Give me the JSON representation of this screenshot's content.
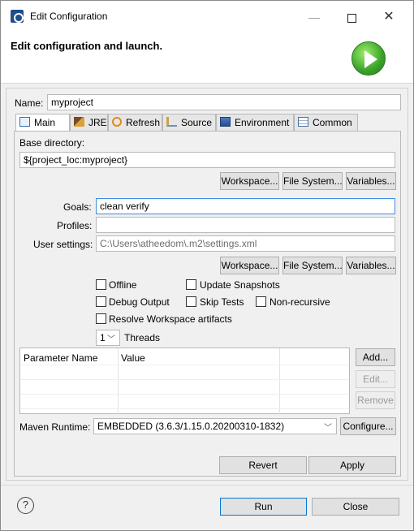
{
  "window": {
    "title": "Edit Configuration"
  },
  "banner": {
    "title": "Edit configuration and launch."
  },
  "name": {
    "label": "Name:",
    "value": "myproject"
  },
  "tabs": [
    {
      "label": "Main",
      "icon": "main-tab-icon",
      "active": true
    },
    {
      "label": "JRE",
      "icon": "jre-icon"
    },
    {
      "label": "Refresh",
      "icon": "refresh-icon"
    },
    {
      "label": "Source",
      "icon": "source-icon"
    },
    {
      "label": "Environment",
      "icon": "environment-icon"
    },
    {
      "label": "Common",
      "icon": "common-icon"
    }
  ],
  "main": {
    "base_dir_label": "Base directory:",
    "base_dir_value": "${project_loc:myproject}",
    "workspace_btn": "Workspace...",
    "filesystem_btn": "File System...",
    "variables_btn": "Variables...",
    "goals_label": "Goals:",
    "goals_value": "clean verify",
    "profiles_label": "Profiles:",
    "profiles_value": "",
    "user_settings_label": "User settings:",
    "user_settings_value": "C:\\Users\\atheedom\\.m2\\settings.xml",
    "options": {
      "offline": "Offline",
      "update_snapshots": "Update Snapshots",
      "debug_output": "Debug Output",
      "skip_tests": "Skip Tests",
      "non_recursive": "Non-recursive",
      "resolve_workspace": "Resolve Workspace artifacts"
    },
    "threads_value": "1",
    "threads_label": "Threads",
    "table": {
      "headers": [
        "Parameter Name",
        "Value"
      ]
    },
    "add_btn": "Add...",
    "edit_btn": "Edit...",
    "remove_btn": "Remove",
    "maven_runtime_label": "Maven Runtime:",
    "maven_runtime_value": "EMBEDDED (3.6.3/1.15.0.20200310-1832)",
    "configure_btn": "Configure...",
    "revert_btn": "Revert",
    "apply_btn": "Apply"
  },
  "footer": {
    "help_symbol": "?",
    "run_btn": "Run",
    "close_btn": "Close"
  },
  "colors": {
    "accent": "#0078d7",
    "run_green": "#3aa12a",
    "focus_border": "#3d8ee0"
  }
}
